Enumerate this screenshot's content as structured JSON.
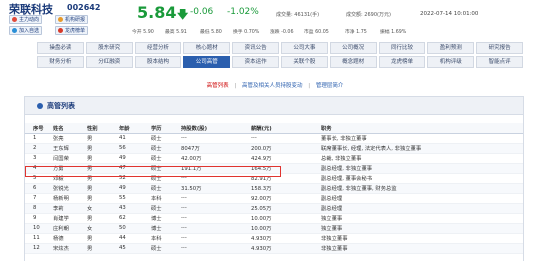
{
  "header": {
    "stock_name": "荣联科技",
    "stock_code": "002642",
    "buttons": [
      "主力动向",
      "机构研报",
      "加入自选",
      "龙虎榜单"
    ],
    "price": "5.84",
    "change": "-0.06",
    "change_pct": "-1.02%",
    "volume": "成交量: 46131(手)",
    "turnover": "成交额: 2690(万元)",
    "datetime": "2022-07-14 10:01:00",
    "row2": [
      "今开 5.90",
      "最高 5.91",
      "最低 5.80",
      "换手 0.70%",
      "涨跌 -0.06",
      "市盈 60.05",
      "市净 1.75",
      "振幅 1.69%"
    ]
  },
  "nav": {
    "row1": [
      "操盘必读",
      "股东研究",
      "经营分析",
      "核心题材",
      "资讯公告",
      "公司大事",
      "公司概况",
      "同行比较",
      "盈利预测",
      "研究报告"
    ],
    "row2": [
      "财务分析",
      "分红融资",
      "股本结构",
      "公司高管",
      "资本运作",
      "关联个股",
      "概念题材",
      "龙虎榜单",
      "机构评级",
      "智能点评"
    ],
    "active": "公司高管"
  },
  "subnav": {
    "items": [
      "高管列表",
      "高管及相关人员持股变动",
      "管理层简介"
    ]
  },
  "section": {
    "title": "高管列表"
  },
  "table": {
    "headers": [
      "序号",
      "姓名",
      "性别",
      "年龄",
      "学历",
      "持股数(股)",
      "薪酬(元)",
      "职务"
    ],
    "rows": [
      [
        "1",
        "张亮",
        "男",
        "41",
        "硕士",
        "---",
        "---",
        "董事长, 非独立董事"
      ],
      [
        "2",
        "王东辉",
        "男",
        "56",
        "硕士",
        "8047万",
        "200.0万",
        "联席董事长, 经理, 法定代表人, 非独立董事"
      ],
      [
        "3",
        "闫国荣",
        "男",
        "49",
        "硕士",
        "42.00万",
        "424.9万",
        "总裁, 非独立董事"
      ],
      [
        "4",
        "方勇",
        "男",
        "47",
        "硕士",
        "191.1万",
        "164.5万",
        "副总经理, 非独立董事"
      ],
      [
        "5",
        "邓毅",
        "男",
        "52",
        "硕士",
        "---",
        "82.91万",
        "副总经理, 董事会秘书"
      ],
      [
        "6",
        "张锐光",
        "男",
        "49",
        "硕士",
        "31.50万",
        "158.3万",
        "副总经理, 非独立董事, 财务总监"
      ],
      [
        "7",
        "杨新明",
        "男",
        "55",
        "本科",
        "---",
        "92.00万",
        "副总经理"
      ],
      [
        "8",
        "李莉",
        "女",
        "43",
        "硕士",
        "---",
        "25.05万",
        "副总经理"
      ],
      [
        "9",
        "肖建学",
        "男",
        "62",
        "博士",
        "---",
        "10.00万",
        "独立董事"
      ],
      [
        "10",
        "庄利朝",
        "女",
        "50",
        "博士",
        "---",
        "10.00万",
        "独立董事"
      ],
      [
        "11",
        "杨德",
        "男",
        "44",
        "本科",
        "---",
        "4.930万",
        "非独立董事"
      ],
      [
        "12",
        "宋炫杰",
        "男",
        "45",
        "硕士",
        "---",
        "4.930万",
        "非独立董事"
      ]
    ]
  },
  "colors": {
    "brand": "#1a3a7a",
    "down": "#1a9a3a",
    "active_nav": "#2b5fae",
    "highlight": "#e0342f"
  }
}
